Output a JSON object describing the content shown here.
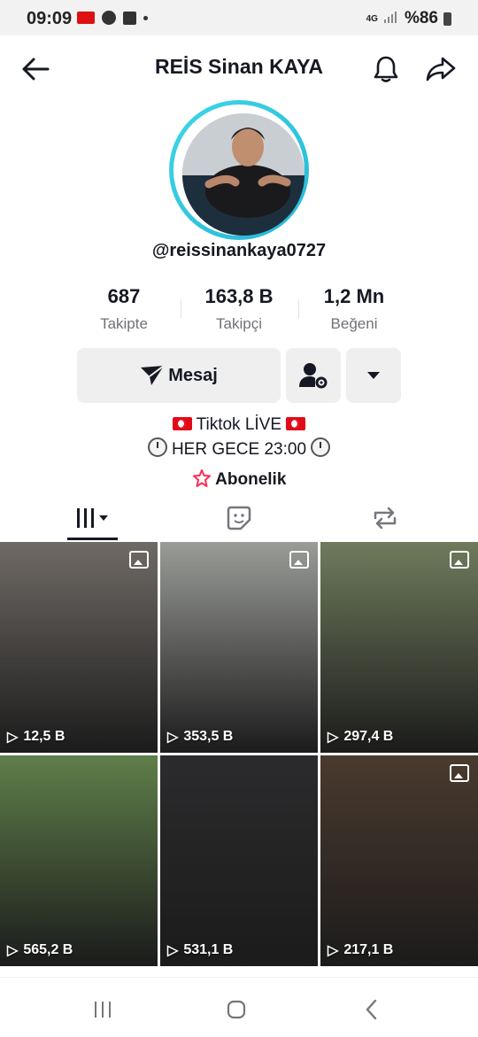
{
  "status_bar": {
    "time": "09:09",
    "network": "4G",
    "battery": "%86"
  },
  "header": {
    "title": "REİS Sinan KAYA"
  },
  "profile": {
    "handle": "@reissinankaya0727",
    "stats": [
      {
        "value": "687",
        "label": "Takipte"
      },
      {
        "value": "163,8 B",
        "label": "Takipçi"
      },
      {
        "value": "1,2 Mn",
        "label": "Beğeni"
      }
    ],
    "actions": {
      "message_label": "Mesaj"
    },
    "bio": {
      "line1": "Tiktok LİVE",
      "line2": "HER GECE 23:00"
    },
    "subscription_label": "Abonelik"
  },
  "tabs": [
    "videos-tab",
    "liked-tab",
    "reposts-tab"
  ],
  "videos": [
    {
      "views": "12,5 B",
      "photo": true,
      "bg": "#6f6a66"
    },
    {
      "views": "353,5 B",
      "photo": true,
      "bg": "#9a9c98"
    },
    {
      "views": "297,4 B",
      "photo": true,
      "bg": "#6f7b5c"
    },
    {
      "views": "565,2 B",
      "photo": false,
      "bg": "#5f7f4a"
    },
    {
      "views": "531,1 B",
      "photo": false,
      "bg": "#2b2b2d"
    },
    {
      "views": "217,1 B",
      "photo": true,
      "bg": "#4a3a2e"
    }
  ],
  "colors": {
    "accent_ring": "#25b7d6",
    "subscribe_icon": "#fe2c55",
    "flag_red": "#e30a17"
  }
}
